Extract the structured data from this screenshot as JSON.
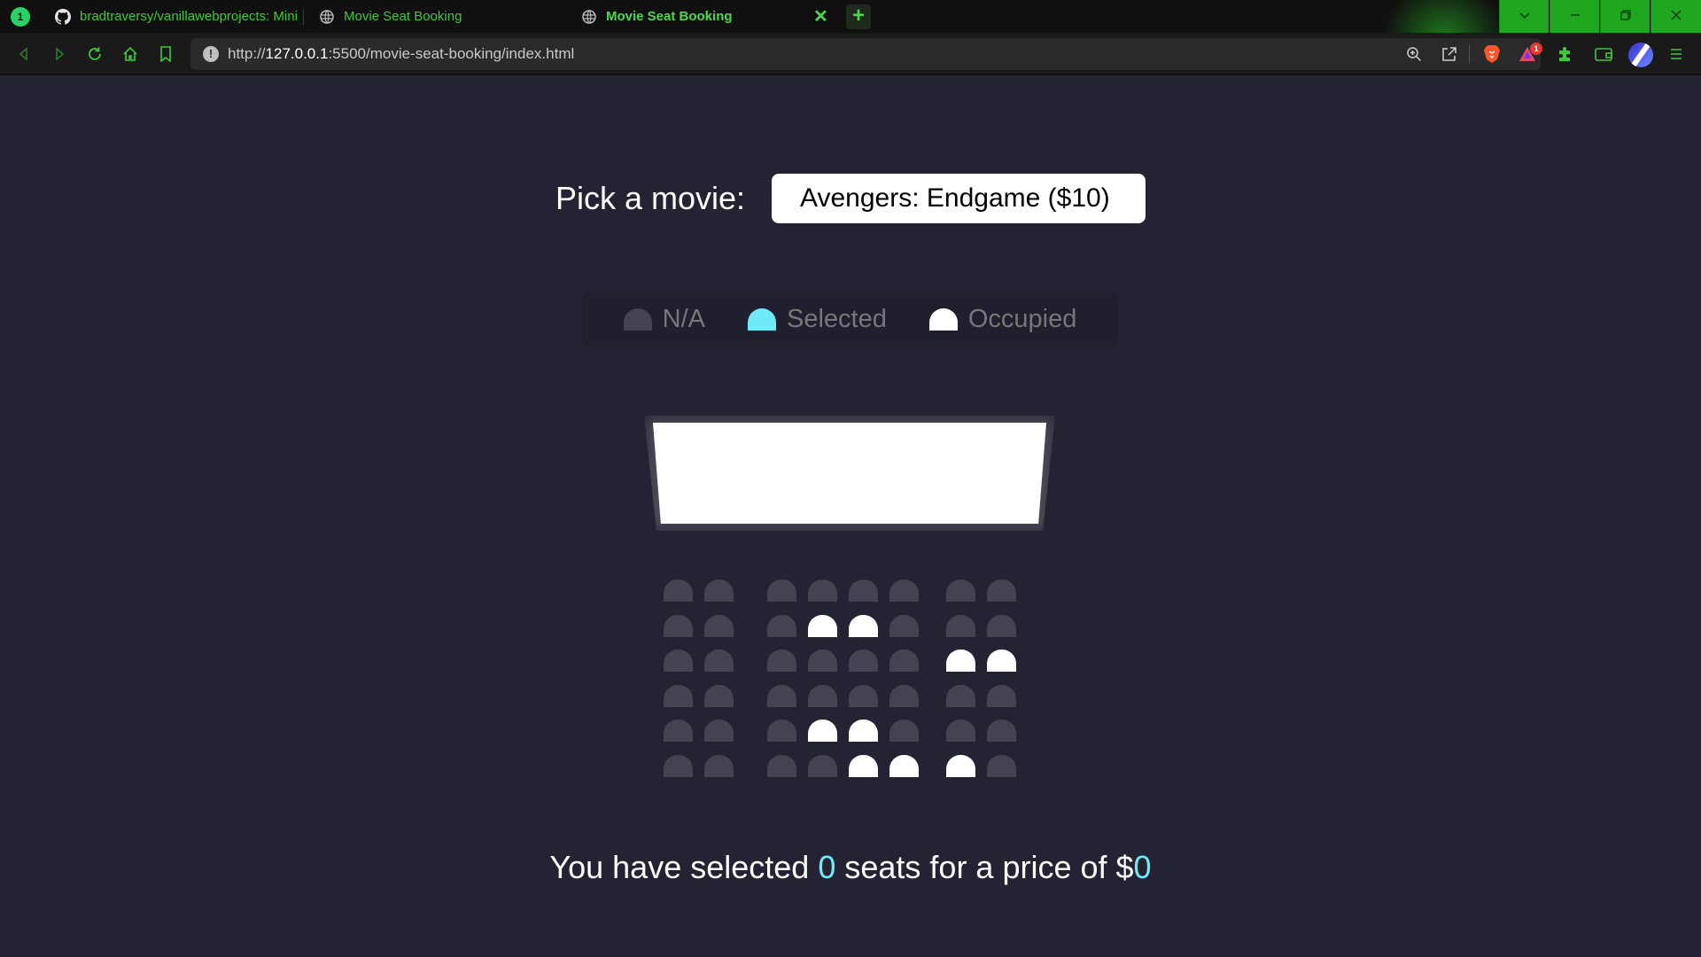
{
  "browser": {
    "whatsapp_badge": "1",
    "tabs": [
      {
        "title": "bradtraversy/vanillawebprojects: Mini",
        "active": false
      },
      {
        "title": "Movie Seat Booking",
        "active": false
      },
      {
        "title": "Movie Seat Booking",
        "active": true
      }
    ],
    "url": "http://127.0.0.1:5500/movie-seat-booking/index.html",
    "url_host": "127.0.0.1",
    "url_prefix": "http://",
    "url_rest": ":5500/movie-seat-booking/index.html",
    "notification_badge": "1",
    "accent_color": "#3ec73e"
  },
  "page": {
    "pick_label": "Pick a movie:",
    "selected_movie": "Avengers: Endgame ($10)",
    "legend": [
      {
        "label": "N/A",
        "status": "na"
      },
      {
        "label": "Selected",
        "status": "selected"
      },
      {
        "label": "Occupied",
        "status": "occupied"
      }
    ],
    "seat_rows": [
      [
        "na",
        "na",
        "na",
        "na",
        "na",
        "na",
        "na",
        "na"
      ],
      [
        "na",
        "na",
        "na",
        "occupied",
        "occupied",
        "na",
        "na",
        "na"
      ],
      [
        "na",
        "na",
        "na",
        "na",
        "na",
        "na",
        "occupied",
        "occupied"
      ],
      [
        "na",
        "na",
        "na",
        "na",
        "na",
        "na",
        "na",
        "na"
      ],
      [
        "na",
        "na",
        "na",
        "occupied",
        "occupied",
        "na",
        "na",
        "na"
      ],
      [
        "na",
        "na",
        "na",
        "na",
        "occupied",
        "occupied",
        "occupied",
        "na"
      ]
    ],
    "summary_prefix": "You have selected",
    "count": "0",
    "summary_middle": "seats for a price of $",
    "total": "0",
    "colors": {
      "background": "#242333",
      "seat": "#444451",
      "selected": "#6feaf6",
      "occupied": "#ffffff"
    }
  }
}
